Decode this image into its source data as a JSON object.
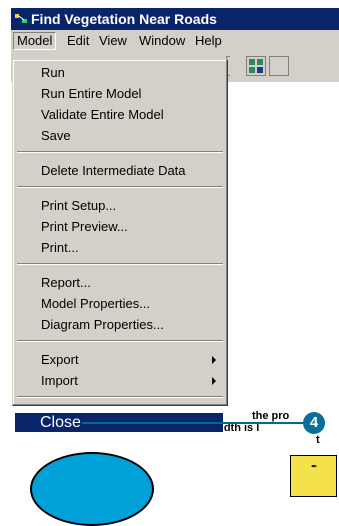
{
  "window": {
    "title": "Find Vegetation Near Roads",
    "title_color": "#0a246a"
  },
  "menubar": {
    "items": [
      "Model",
      "Edit",
      "View",
      "Window",
      "Help"
    ]
  },
  "menu": {
    "groups": [
      [
        "Run",
        "Run Entire Model",
        "Validate Entire Model",
        "Save"
      ],
      [
        "Delete Intermediate Data"
      ],
      [
        "Print Setup...",
        "Print Preview...",
        "Print..."
      ],
      [
        "Report...",
        "Model Properties...",
        "Diagram Properties..."
      ],
      [
        "Export",
        "Import"
      ],
      [
        "Close"
      ]
    ],
    "selected": "Close",
    "selected_color": "#0a246a"
  },
  "callout": {
    "number": "4",
    "color": "#0a7098"
  },
  "background_text": {
    "line1": "the pro",
    "line2": "buffer width is l",
    "line3": "t"
  },
  "colors": {
    "ellipse": "#00a0d8",
    "rect": "#f5e24a",
    "chrome": "#d4d0c8"
  }
}
